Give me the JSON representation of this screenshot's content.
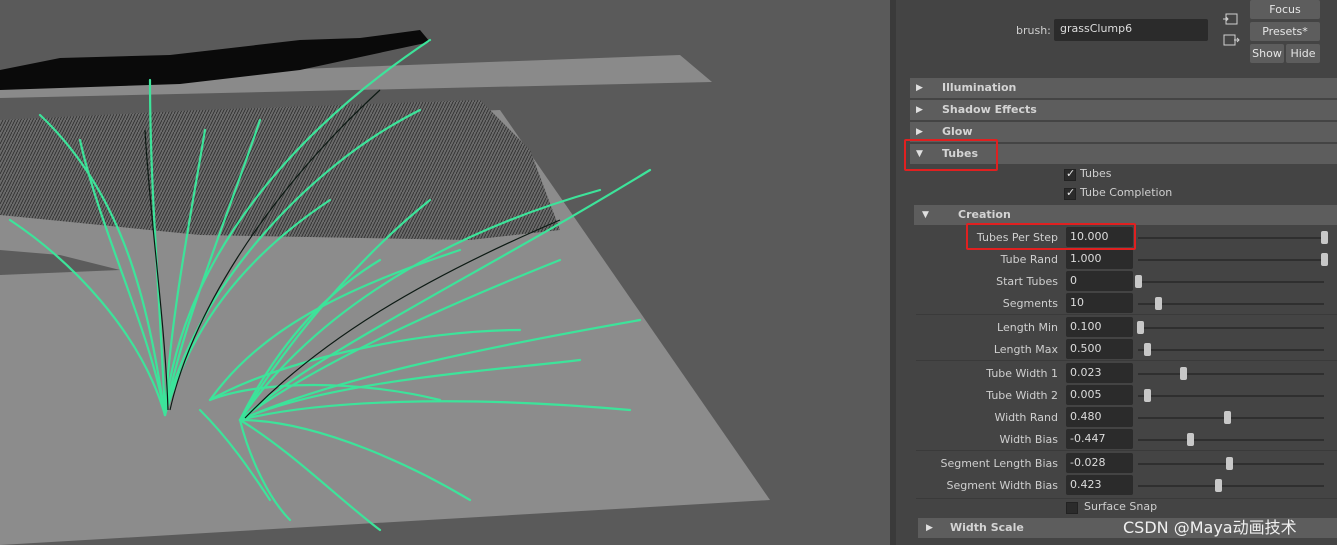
{
  "panel": {
    "brush_label": "brush:",
    "brush_value": "grassClump6",
    "buttons": {
      "focus": "Focus",
      "presets": "Presets*",
      "show": "Show",
      "hide": "Hide"
    }
  },
  "sections": {
    "illumination": "Illumination",
    "shadow_effects": "Shadow Effects",
    "glow": "Glow",
    "tubes": "Tubes",
    "creation": "Creation",
    "width_scale": "Width Scale"
  },
  "checkboxes": {
    "tubes": {
      "label": "Tubes",
      "checked": true
    },
    "tube_completion": {
      "label": "Tube Completion",
      "checked": true
    },
    "surface_snap": {
      "label": "Surface Snap",
      "checked": false
    }
  },
  "attributes": [
    {
      "label": "Tubes Per Step",
      "value": "10.000",
      "slider": 1.0
    },
    {
      "label": "Tube Rand",
      "value": "1.000",
      "slider": 1.0
    },
    {
      "label": "Start Tubes",
      "value": "0",
      "slider": 0.0
    },
    {
      "label": "Segments",
      "value": "10",
      "slider": 0.11
    },
    {
      "label": "Length Min",
      "value": "0.100",
      "slider": 0.01
    },
    {
      "label": "Length Max",
      "value": "0.500",
      "slider": 0.05
    },
    {
      "label": "Tube Width 1",
      "value": "0.023",
      "slider": 0.24
    },
    {
      "label": "Tube Width 2",
      "value": "0.005",
      "slider": 0.05
    },
    {
      "label": "Width Rand",
      "value": "0.480",
      "slider": 0.48
    },
    {
      "label": "Width Bias",
      "value": "-0.447",
      "slider": 0.28
    },
    {
      "label": "Segment Length Bias",
      "value": "-0.028",
      "slider": 0.49
    },
    {
      "label": "Segment Width Bias",
      "value": "0.423",
      "slider": 0.43
    }
  ],
  "watermark": "CSDN @Maya动画技术",
  "colors": {
    "highlight": "#e02020",
    "grass": "#3de39a",
    "panel_bg": "#444444"
  }
}
